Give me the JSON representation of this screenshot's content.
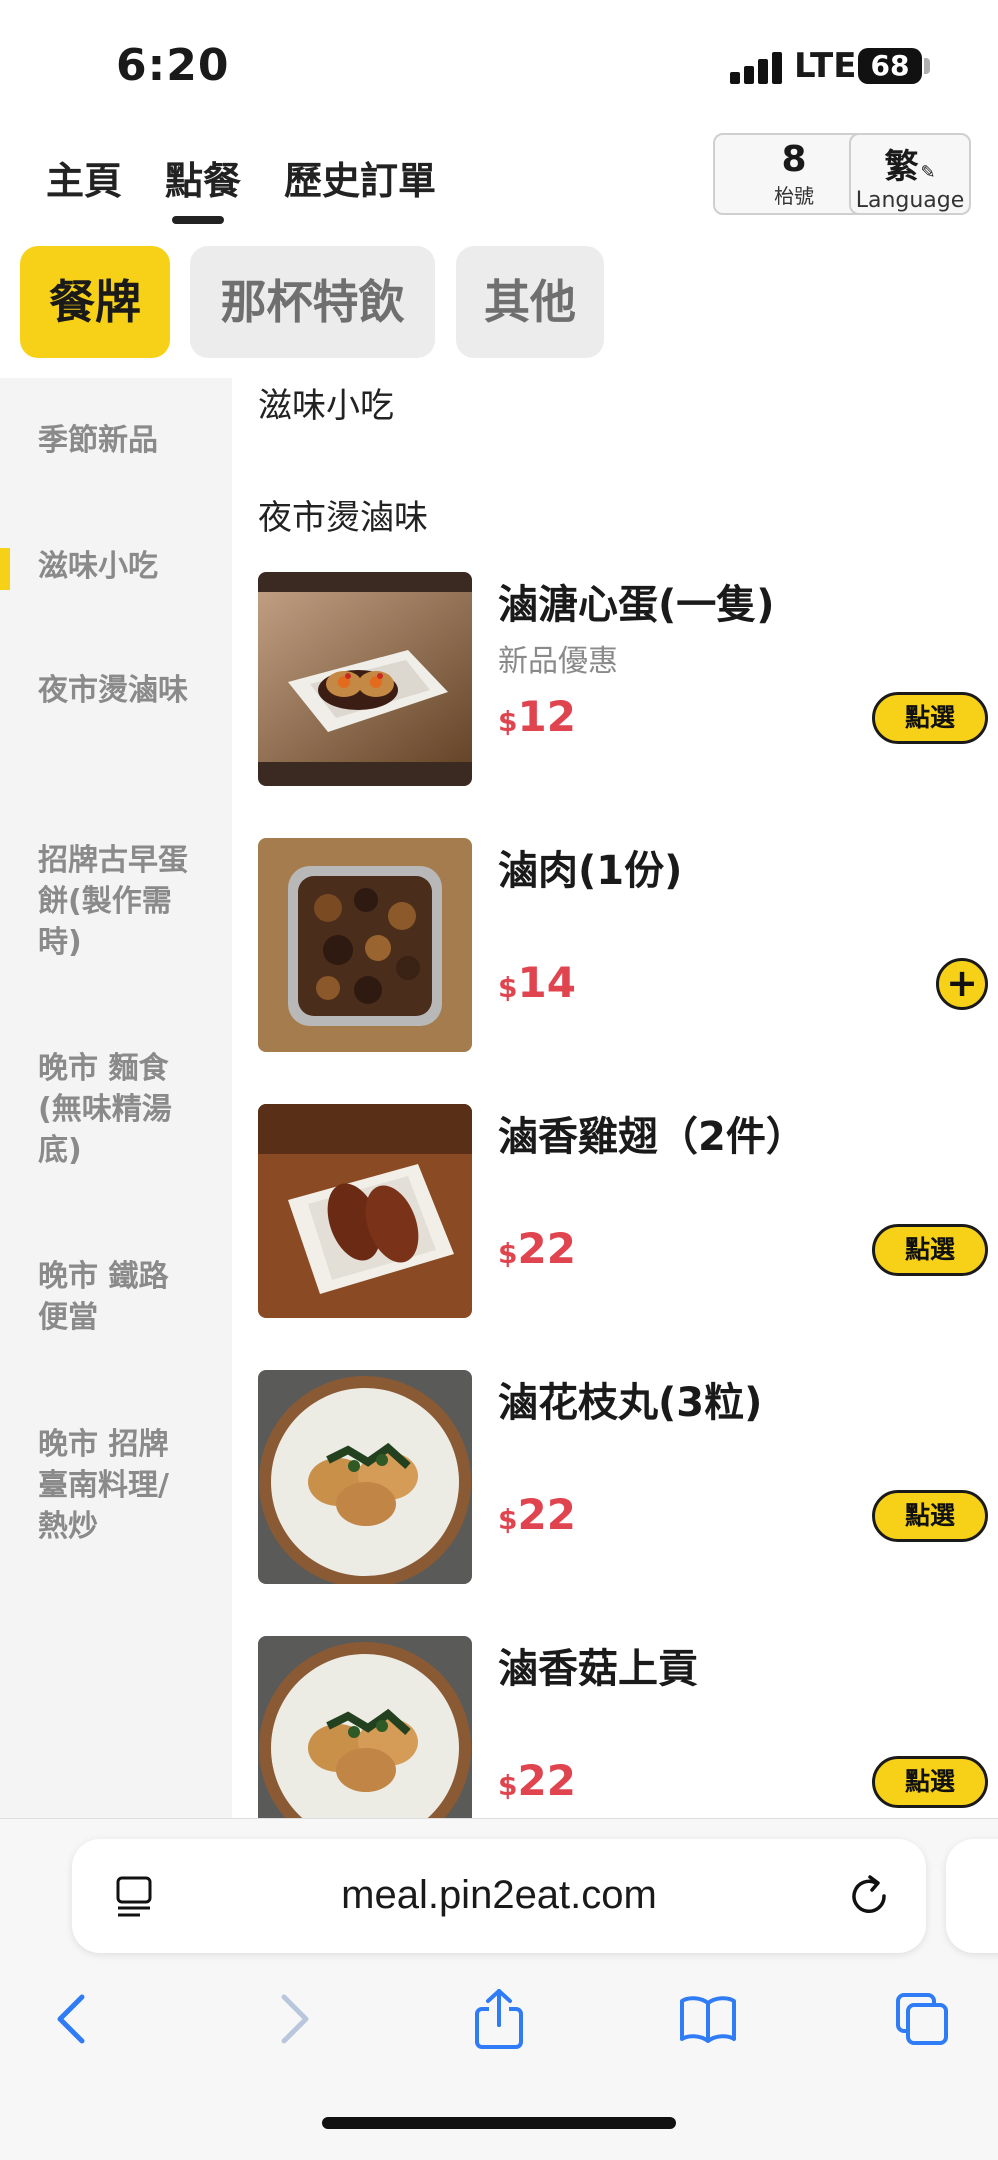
{
  "status_bar": {
    "time": "6:20",
    "network": "LTE",
    "battery": "68"
  },
  "nav": {
    "tabs": [
      {
        "label": "主頁",
        "active": false
      },
      {
        "label": "點餐",
        "active": true
      },
      {
        "label": "歷史訂單",
        "active": false
      }
    ],
    "table_number": "8",
    "table_label": "枱號",
    "language_char": "繁",
    "language_label": "Language"
  },
  "category_tabs": [
    {
      "label": "餐牌",
      "active": true
    },
    {
      "label": "那杯特飲",
      "active": false
    },
    {
      "label": "其他",
      "active": false
    }
  ],
  "sidebar": {
    "items": [
      {
        "label": "季節新品",
        "active": false
      },
      {
        "label": "滋味小吃",
        "active": true
      },
      {
        "label": "夜市燙滷味",
        "active": false
      },
      {
        "label": "招牌古早蛋餅(製作需時)",
        "active": false
      },
      {
        "label": "晚市 麵食(無味精湯底)",
        "active": false
      },
      {
        "label": "晚市 鐵路便當",
        "active": false
      },
      {
        "label": "晚市 招牌臺南料理/熱炒",
        "active": false
      }
    ]
  },
  "content": {
    "section_title": "滋味小吃",
    "subsection_title": "夜市燙滷味",
    "currency_symbol": "$",
    "pick_label": "點選",
    "plus_label": "+",
    "items": [
      {
        "name": "滷溏心蛋(一隻)",
        "subtitle": "新品優惠",
        "price": "12",
        "action": "pick",
        "image": "braised-egg"
      },
      {
        "name": "滷肉(1份)",
        "subtitle": "",
        "price": "14",
        "action": "plus",
        "image": "braised-pork"
      },
      {
        "name": "滷香雞翅（2件）",
        "subtitle": "",
        "price": "22",
        "action": "pick",
        "image": "chicken-wings"
      },
      {
        "name": "滷花枝丸(3粒)",
        "subtitle": "",
        "price": "22",
        "action": "pick",
        "image": "squid-balls"
      },
      {
        "name": "滷香菇上貢",
        "subtitle": "",
        "price": "22",
        "action": "pick",
        "image": "mushroom-balls"
      }
    ]
  },
  "browser": {
    "url": "meal.pin2eat.com"
  },
  "colors": {
    "accent": "#f7d117",
    "price": "#e0454f",
    "sidebar_bg": "#f4f4f4",
    "ios_blue": "#2f7cf6"
  }
}
